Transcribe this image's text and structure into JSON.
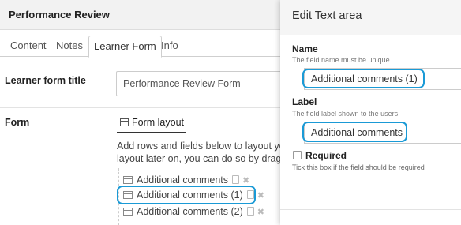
{
  "page": {
    "title": "Performance Review"
  },
  "tabs": [
    {
      "label": "Content",
      "active": false
    },
    {
      "label": "Notes",
      "active": false
    },
    {
      "label": "Learner Form",
      "active": true
    },
    {
      "label": "Info",
      "active": false
    }
  ],
  "learner_form": {
    "title_label": "Learner form title",
    "title_value": "Performance Review Form",
    "form_label": "Form",
    "layout_heading": "Form layout",
    "desc_line1": "Add rows and fields below to layout yo",
    "desc_line2": "layout later on, you can do so by draggi",
    "fields": [
      {
        "label": "Additional comments"
      },
      {
        "label": "Additional comments (1)"
      },
      {
        "label": "Additional comments (2)"
      }
    ]
  },
  "panel": {
    "title": "Edit Text area",
    "name_label": "Name",
    "name_help": "The field name must be unique",
    "name_value": "Additional comments (1)",
    "label_label": "Label",
    "label_help": "The field label shown to the users",
    "label_value": "Additional comments",
    "required_label": "Required",
    "required_checked": false,
    "required_help": "Tick this box if the field should be required"
  },
  "colors": {
    "highlight": "#1a9ad6"
  },
  "icons": {
    "field": "text-area-icon",
    "copy": "copy-icon",
    "delete": "delete-icon",
    "layout": "form-layout-icon"
  }
}
